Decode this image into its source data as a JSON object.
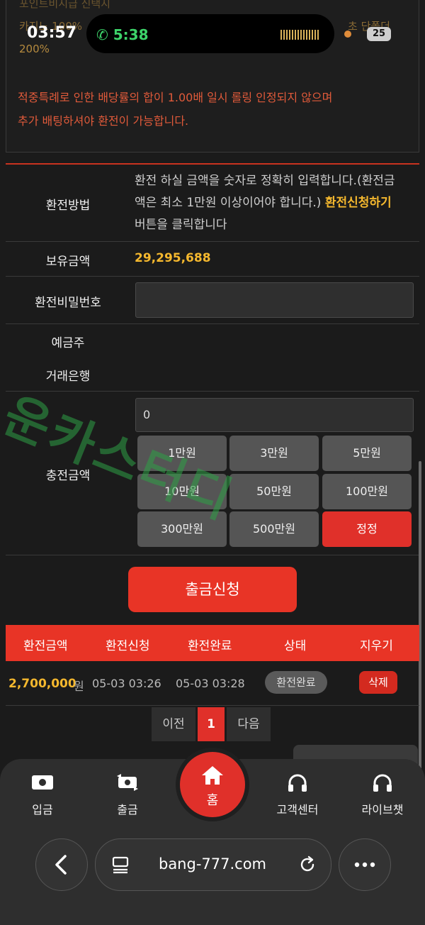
{
  "notice": {
    "faded_title": "포인트비시급 신택지",
    "faded_line1": "카지노 100%",
    "faded_line1_right": "초 단폴더",
    "faded_line2": "200%",
    "warning_line1": "적중특례로 인한 배당률의 합이 1.00배 일시 롤링 인정되지 않으며",
    "warning_line2": "추가 배팅하셔야 환전이 가능합니다."
  },
  "status_bar": {
    "time": "03:57",
    "call_time": "5:38",
    "battery": "25"
  },
  "form": {
    "method_label": "환전방법",
    "method_desc_a": "환전 하실 금액을 숫자로 정확히 입력합니다.(환전금",
    "method_desc_b": "액은 최소 1만원 이상이어야 합니다.) ",
    "method_desc_highlight": "환전신청하기",
    "method_desc_c": "버튼을 클릭합니다",
    "balance_label": "보유금액",
    "balance_value": "29,295,688",
    "password_label": "환전비밀번호",
    "password_value": "",
    "holder_label": "예금주",
    "bank_label": "거래은행",
    "amount_label": "충전금액",
    "amount_value": "0"
  },
  "amount_buttons": [
    "1만원",
    "3만원",
    "5만원",
    "10만원",
    "50만원",
    "100만원",
    "300만원",
    "500만원",
    "정정"
  ],
  "submit_label": "출금신청",
  "table": {
    "headers": [
      "환전금액",
      "환전신청",
      "환전완료",
      "상태",
      "지우기"
    ],
    "row": {
      "amount": "2,700,000",
      "unit": "원",
      "requested": "05-03 03:26",
      "completed": "05-03 03:28",
      "status": "환전완료",
      "delete": "삭제"
    }
  },
  "pager": {
    "prev": "이전",
    "page": "1",
    "next": "다음"
  },
  "watermark": "운카스터디",
  "bottom_nav": {
    "deposit": "입금",
    "withdraw": "출금",
    "home": "홈",
    "support": "고객센터",
    "live_chat": "라이브챗"
  },
  "browser": {
    "url": "bang-777.com"
  },
  "colors": {
    "accent_red": "#e83426",
    "gold": "#f5b82e",
    "background": "#1b1b1b"
  }
}
